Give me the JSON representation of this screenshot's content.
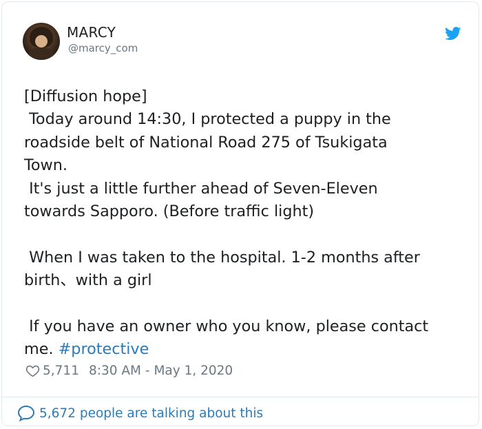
{
  "author": {
    "name": "MARCY",
    "handle": "@marcy_com"
  },
  "tweet": {
    "text_lines": [
      "[Diffusion hope]",
      " Today around 14:30, I protected a puppy in the",
      "roadside belt of National Road 275 of Tsukigata",
      "Town.",
      " It's just a little further ahead of Seven-Eleven",
      "towards Sapporo. (Before traffic light)",
      "",
      " When I was taken to the hospital. 1-2 months after",
      "birth、with a girl",
      "",
      " If you have an owner who you know, please contact",
      "me. "
    ],
    "hashtag": "#protective"
  },
  "meta": {
    "likes": "5,711",
    "timestamp": "8:30 AM - May 1, 2020"
  },
  "footer": {
    "talking": "5,672 people are talking about this"
  },
  "icons": {
    "bird": "twitter-bird-icon",
    "heart": "heart-icon",
    "bubble": "speech-bubble-icon"
  },
  "colors": {
    "accent": "#2b7bb9",
    "bird": "#1da1f2",
    "muted": "#697882",
    "text": "#1c2022",
    "border": "#e1e8ed"
  }
}
